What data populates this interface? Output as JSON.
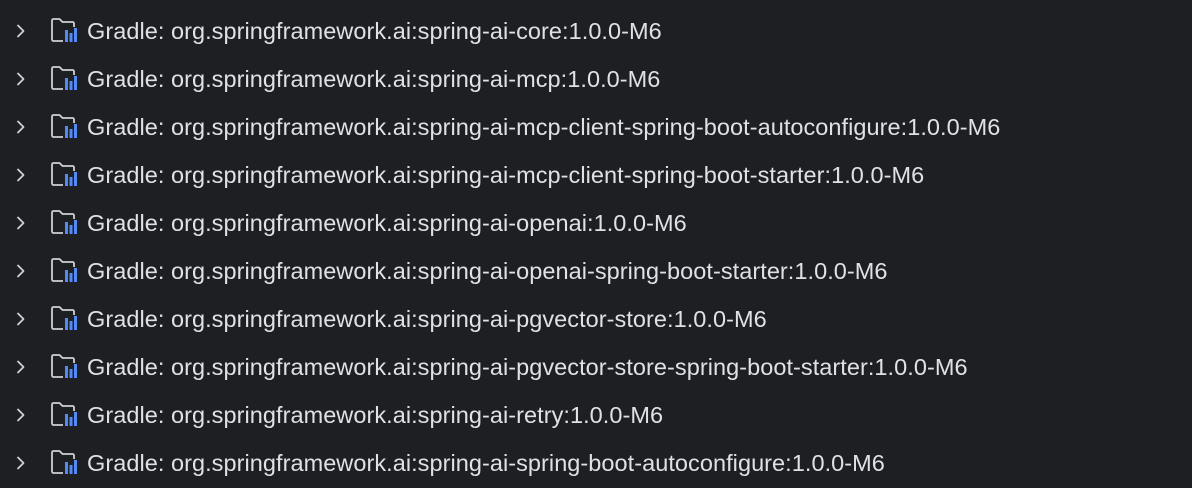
{
  "tree": {
    "items": [
      {
        "label": "Gradle: org.springframework.ai:spring-ai-core:1.0.0-M6"
      },
      {
        "label": "Gradle: org.springframework.ai:spring-ai-mcp:1.0.0-M6"
      },
      {
        "label": "Gradle: org.springframework.ai:spring-ai-mcp-client-spring-boot-autoconfigure:1.0.0-M6"
      },
      {
        "label": "Gradle: org.springframework.ai:spring-ai-mcp-client-spring-boot-starter:1.0.0-M6"
      },
      {
        "label": "Gradle: org.springframework.ai:spring-ai-openai:1.0.0-M6"
      },
      {
        "label": "Gradle: org.springframework.ai:spring-ai-openai-spring-boot-starter:1.0.0-M6"
      },
      {
        "label": "Gradle: org.springframework.ai:spring-ai-pgvector-store:1.0.0-M6"
      },
      {
        "label": "Gradle: org.springframework.ai:spring-ai-pgvector-store-spring-boot-starter:1.0.0-M6"
      },
      {
        "label": "Gradle: org.springframework.ai:spring-ai-retry:1.0.0-M6"
      },
      {
        "label": "Gradle: org.springframework.ai:spring-ai-spring-boot-autoconfigure:1.0.0-M6"
      }
    ],
    "expand_icon": "chevron-right-icon",
    "item_icon": "library-folder-icon"
  },
  "colors": {
    "background": "#1e1f22",
    "text": "#dfe1e5",
    "icon_outline": "#ced0d6",
    "icon_accent": "#548af7"
  }
}
